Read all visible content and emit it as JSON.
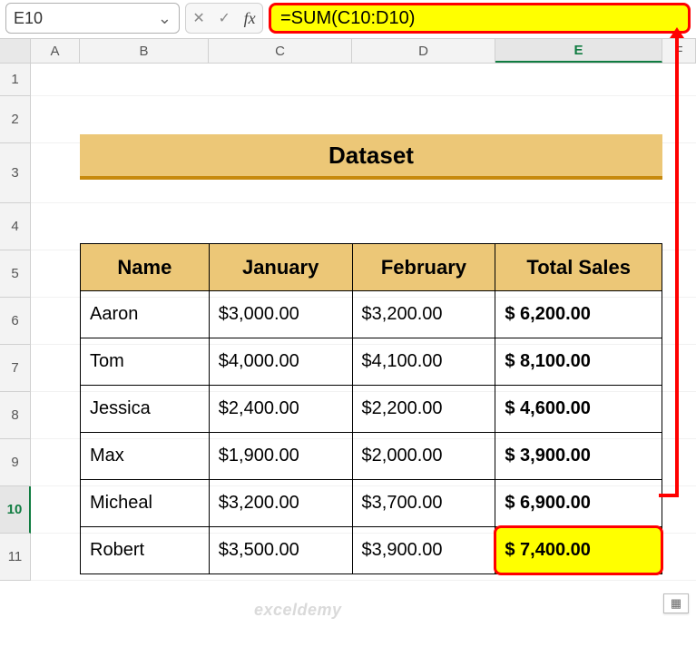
{
  "namebox": {
    "value": "E10"
  },
  "formula_bar": {
    "value": "=SUM(C10:D10)"
  },
  "columns": {
    "A": "A",
    "B": "B",
    "C": "C",
    "D": "D",
    "E": "E",
    "F": "F"
  },
  "row_labels": [
    "1",
    "2",
    "3",
    "4",
    "5",
    "6",
    "7",
    "8",
    "9",
    "10",
    "11"
  ],
  "title": "Dataset",
  "table": {
    "headers": {
      "name": "Name",
      "jan": "January",
      "feb": "February",
      "total": "Total Sales"
    },
    "rows": [
      {
        "name": "Aaron",
        "jan": "$3,000.00",
        "feb": "$3,200.00",
        "total": "$  6,200.00"
      },
      {
        "name": "Tom",
        "jan": "$4,000.00",
        "feb": "$4,100.00",
        "total": "$  8,100.00"
      },
      {
        "name": "Jessica",
        "jan": "$2,400.00",
        "feb": "$2,200.00",
        "total": "$  4,600.00"
      },
      {
        "name": "Max",
        "jan": "$1,900.00",
        "feb": "$2,000.00",
        "total": "$  3,900.00"
      },
      {
        "name": "Micheal",
        "jan": "$3,200.00",
        "feb": "$3,700.00",
        "total": "$  6,900.00"
      },
      {
        "name": "Robert",
        "jan": "$3,500.00",
        "feb": "$3,900.00",
        "total": "$  7,400.00"
      }
    ]
  },
  "chart_data": {
    "type": "table",
    "title": "Dataset",
    "columns": [
      "Name",
      "January",
      "February",
      "Total Sales"
    ],
    "rows": [
      [
        "Aaron",
        3000.0,
        3200.0,
        6200.0
      ],
      [
        "Tom",
        4000.0,
        4100.0,
        8100.0
      ],
      [
        "Jessica",
        2400.0,
        2200.0,
        4600.0
      ],
      [
        "Max",
        1900.0,
        2000.0,
        3900.0
      ],
      [
        "Micheal",
        3200.0,
        3700.0,
        6900.0
      ],
      [
        "Robert",
        3500.0,
        3900.0,
        7400.0
      ]
    ],
    "formula": "=SUM(C10:D10)",
    "active_cell": "E10"
  },
  "watermark": "exceldemy",
  "icons": {
    "chev": "⌄",
    "cancel": "✕",
    "check": "✓",
    "fx": "fx",
    "paste": "▦"
  }
}
